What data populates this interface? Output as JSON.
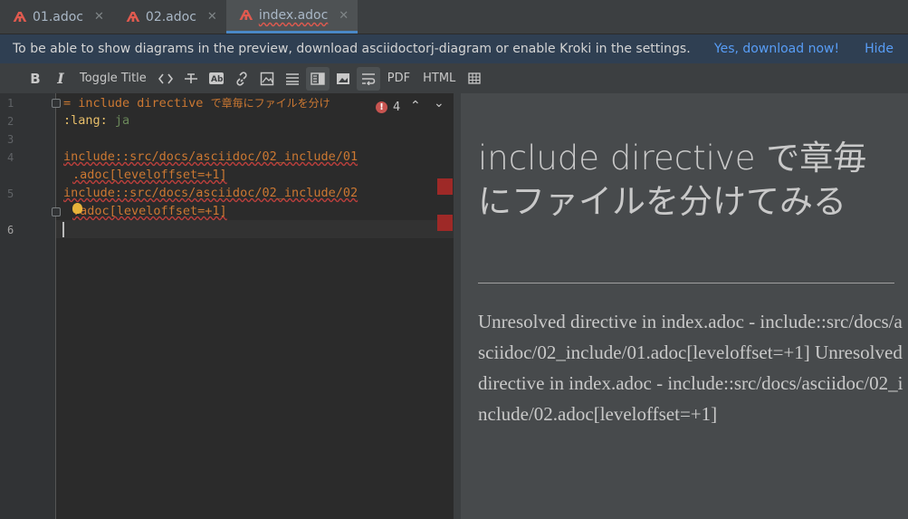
{
  "tabs": [
    {
      "label": "01.adoc",
      "icon": "asciidoc-icon"
    },
    {
      "label": "02.adoc",
      "icon": "asciidoc-icon"
    },
    {
      "label": "index.adoc",
      "icon": "asciidoc-icon"
    }
  ],
  "notification": {
    "message": "To be able to show diagrams in the preview, download asciidoctorj-diagram or enable Kroki in the settings.",
    "action": "Yes, download now!",
    "hide": "Hide"
  },
  "toolbar": {
    "bold": "B",
    "italic": "I",
    "toggle_title": "Toggle Title",
    "pdf": "PDF",
    "html": "HTML"
  },
  "editor": {
    "line_numbers": [
      "1",
      "2",
      "3",
      "4",
      "5",
      "6"
    ],
    "line1_prefix": "= include directive ",
    "line1_jp": "で章毎にファイルを分け",
    "line2_attr": ":lang:",
    "line2_value": " ja",
    "line4a": "include::src/docs/asciidoc/02_include/01",
    "line4b": ".adoc[leveloffset=+1]",
    "line5a": "include::src/docs/asciidoc/02_include/02",
    "line5b": ".adoc[leveloffset=+1]",
    "error_count": "4"
  },
  "preview": {
    "title": "include directive で章毎にファイルを分けてみる",
    "body": "Unresolved directive in index.adoc - include::src/docs/asciidoc/02_include/01.adoc[leveloffset=+1] Unresolved directive in index.adoc - include::src/docs/asciidoc/02_include/02.adoc[leveloffset=+1]"
  },
  "colors": {
    "accent": "#4a88c7",
    "error": "#c75450",
    "link": "#589df6"
  }
}
